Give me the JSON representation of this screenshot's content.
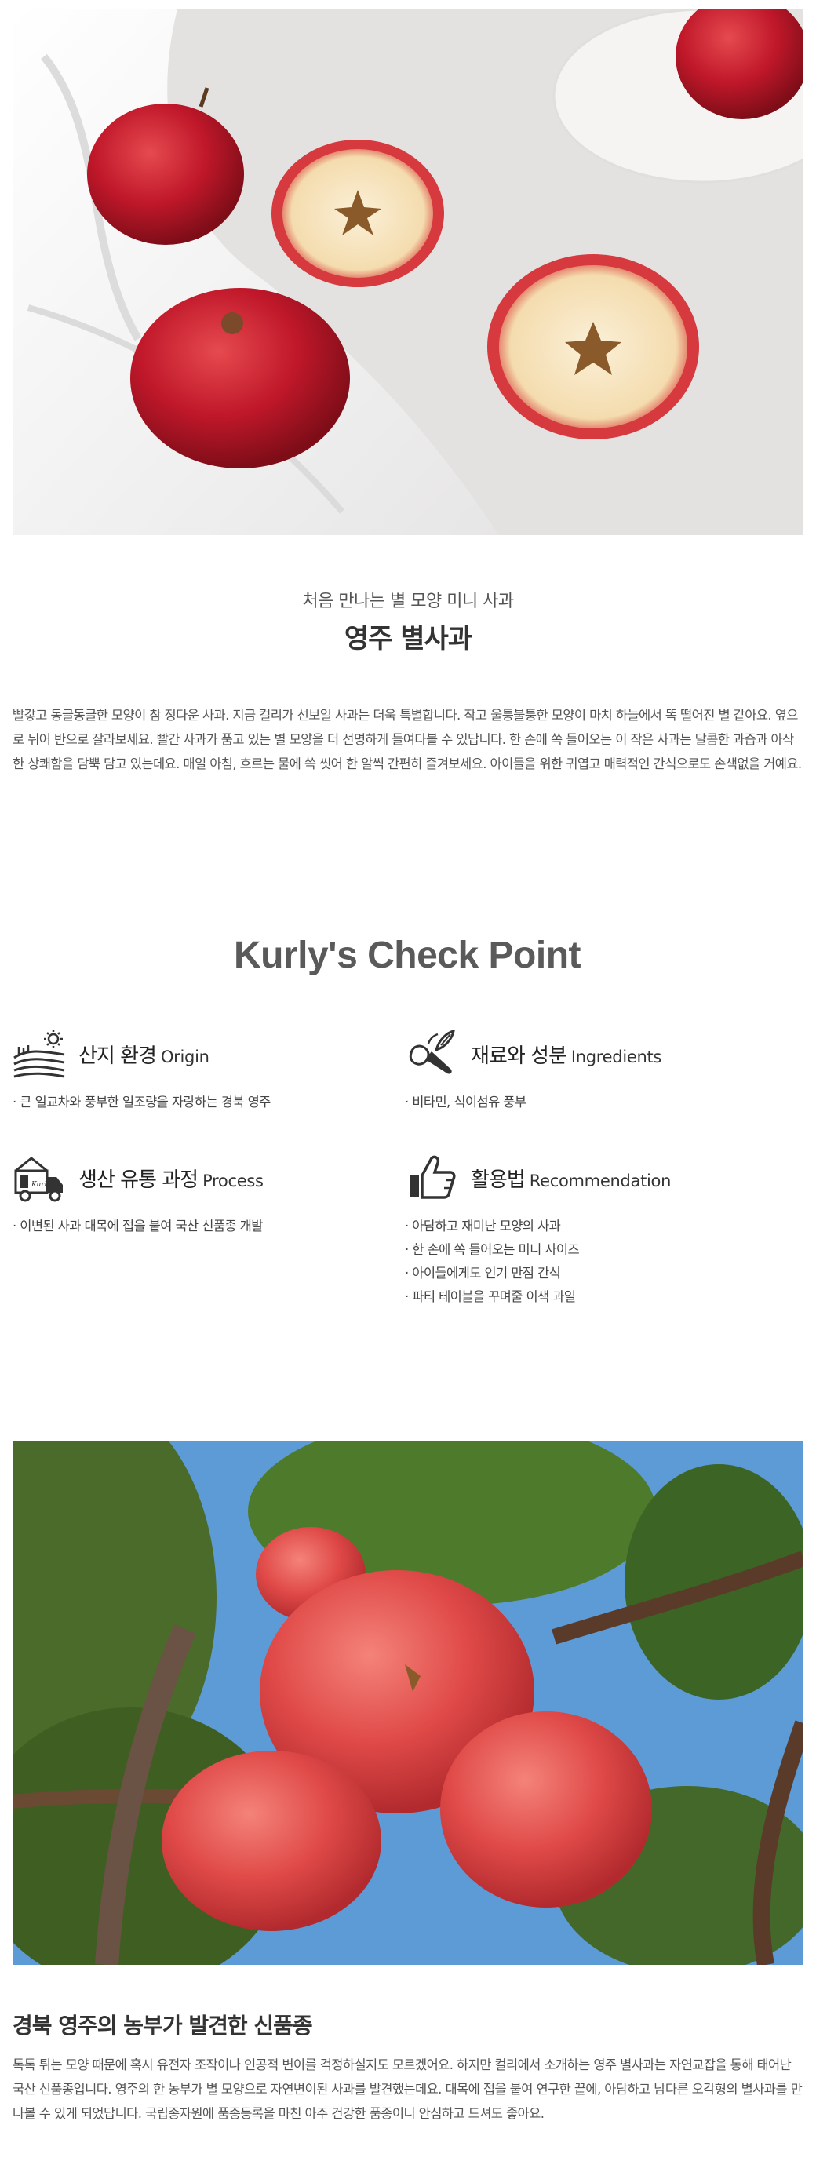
{
  "intro": {
    "subtitle": "처음 만나는 별 모양 미니 사과",
    "title": "영주 별사과",
    "description": "빨갛고 동글동글한 모양이 참 정다운 사과. 지금 컬리가 선보일 사과는 더욱 특별합니다. 작고 울퉁불퉁한 모양이 마치 하늘에서 똑 떨어진 별 같아요. 옆으로 뉘어 반으로 잘라보세요. 빨간 사과가 품고 있는 별 모양을 더 선명하게 들여다볼 수 있답니다. 한 손에 쏙 들어오는 이 작은 사과는 달콤한 과즙과 아삭한 상쾌함을 담뿍 담고 있는데요. 매일 아침, 흐르는 물에 쓱 씻어 한 알씩 간편히 즐겨보세요. 아이들을 위한 귀엽고 매력적인 간식으로도 손색없을 거예요."
  },
  "check_point": {
    "title": "Kurly's Check Point",
    "origin": {
      "icon": "farm-field-sun-icon",
      "label_ko": "산지 환경",
      "label_en": "Origin",
      "items": [
        "큰 일교차와 풍부한 일조량을 자랑하는 경북 영주"
      ]
    },
    "ingredients": {
      "icon": "vegetables-icon",
      "label_ko": "재료와 성분",
      "label_en": "Ingredients",
      "items": [
        "비타민, 식이섬유 풍부"
      ]
    },
    "process": {
      "icon": "delivery-truck-icon",
      "label_ko": "생산 유통 과정",
      "label_en": "Process",
      "items": [
        "이변된 사과 대목에 접을 붙여 국산 신품종 개발"
      ]
    },
    "recommendation": {
      "icon": "thumbs-up-icon",
      "label_ko": "활용법",
      "label_en": "Recommendation",
      "items": [
        "아담하고 재미난 모양의 사과",
        "한 손에 쏙 들어오는 미니 사이즈",
        "아이들에게도 인기 만점 간식",
        "파티 테이블을 꾸며줄 이색 과일"
      ]
    }
  },
  "farm": {
    "title": "경북 영주의 농부가 발견한 신품종",
    "description": "톡톡 튀는 모양 때문에 혹시 유전자 조작이나 인공적 변이를 걱정하실지도 모르겠어요. 하지만 컬리에서 소개하는 영주 별사과는 자연교잡을 통해 태어난 국산 신품종입니다. 영주의 한 농부가 별 모양으로 자연변이된 사과를 발견했는데요. 대목에 접을 붙여 연구한 끝에, 아담하고 남다른 오각형의 별사과를 만나볼 수 있게 되었답니다. 국립종자원에 품종등록을 마친 아주 건강한 품종이니 안심하고 드셔도 좋아요."
  },
  "colors": {
    "apple_red": "#c0182a",
    "sky_blue": "#5d9bd6",
    "text_dark": "#333333"
  }
}
